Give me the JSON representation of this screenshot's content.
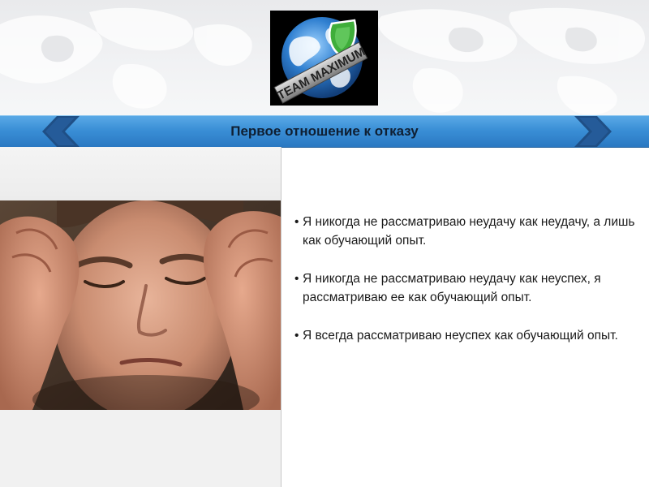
{
  "logo": {
    "text": "TEAM MAXIMUM"
  },
  "title_bar": {
    "title": "Первое отношение к отказу"
  },
  "bullets": [
    {
      "text": "Я никогда не рассматриваю неудачу как неудачу, а лишь как обучающий опыт."
    },
    {
      "text": "Я никогда не рассматриваю неудачу как неуспех, я рассматриваю ее как обучающий опыт."
    },
    {
      "text": "Я всегда рассматриваю неуспех как обучающий опыт."
    }
  ],
  "colors": {
    "title_bar": "#3a8fd6",
    "arrow": "#1f4f86",
    "header_background": "#eeeff1",
    "logo_background": "#000000",
    "globe": "#2f7fd0",
    "shield": "#3fae3a"
  },
  "icons": [
    "globe-icon",
    "shield-icon",
    "chevron-left-icon",
    "chevron-right-icon"
  ]
}
